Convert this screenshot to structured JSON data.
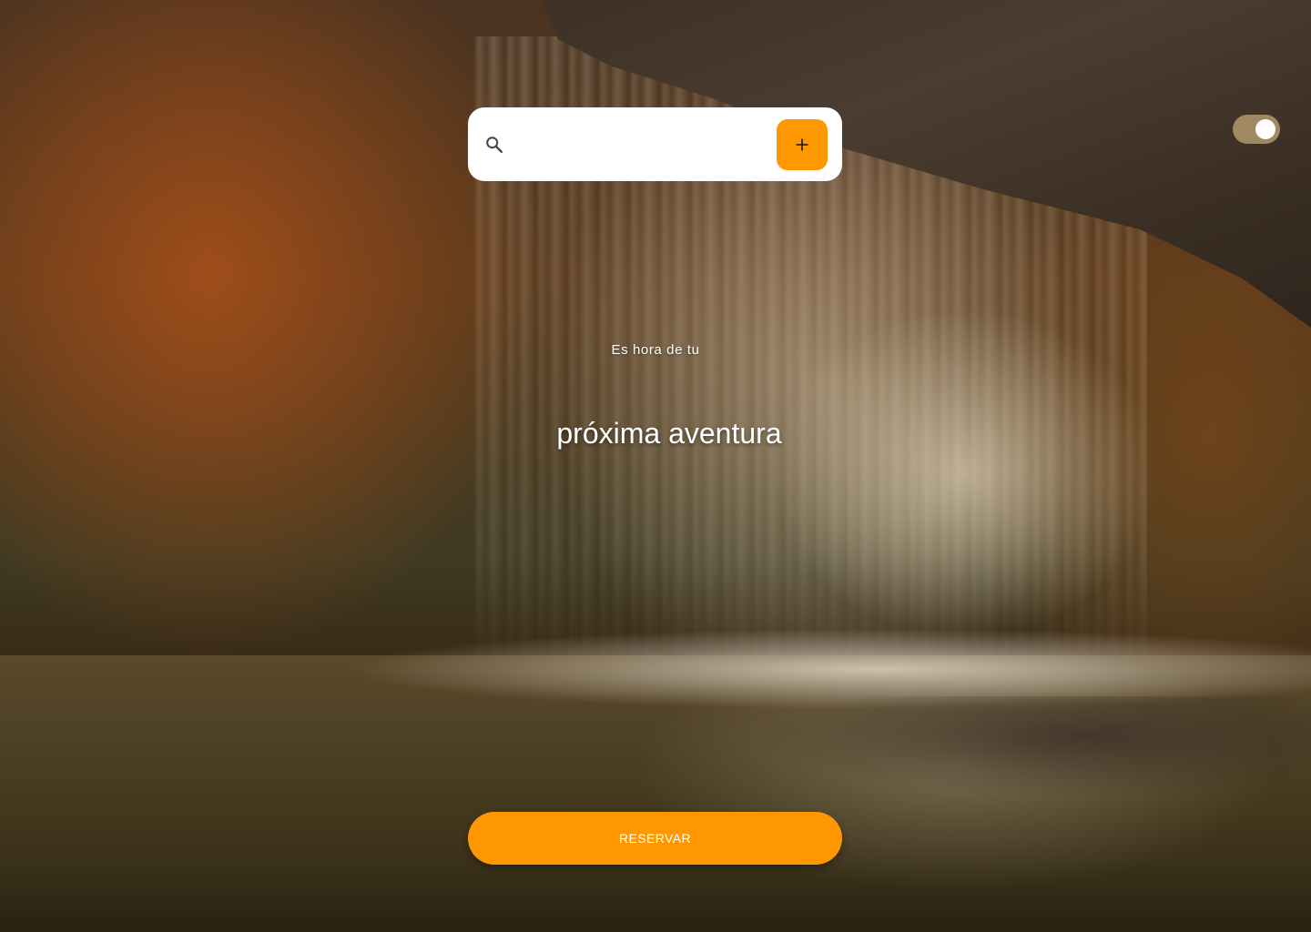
{
  "search": {
    "placeholder": "",
    "value": "",
    "icon": "search-icon",
    "add_icon": "plus-icon"
  },
  "toggle": {
    "state": "on",
    "track_color": "#a08863",
    "knob_color": "#ffffff"
  },
  "hero": {
    "subtitle": "Es hora de tu",
    "title": "próxima aventura"
  },
  "actions": {
    "reserve_label": "RESERVAR"
  },
  "colors": {
    "accent": "#ff9800",
    "text_on_image": "#ffffff"
  },
  "background": {
    "image": "waterfall-forest-photo"
  }
}
